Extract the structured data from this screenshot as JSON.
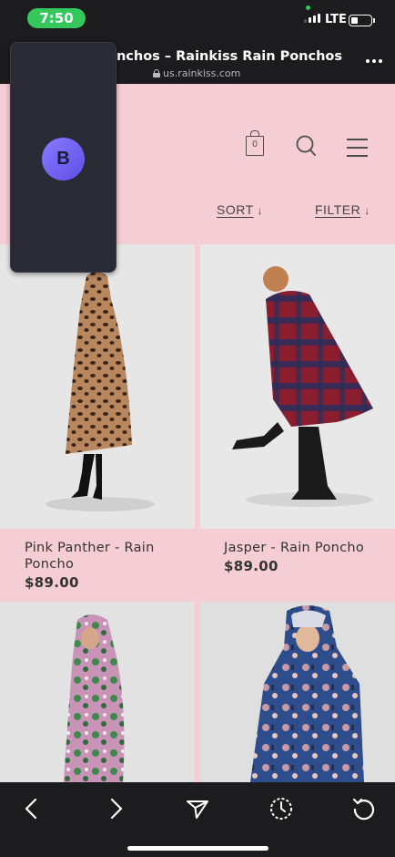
{
  "status": {
    "time": "7:50",
    "network": "LTE"
  },
  "browser": {
    "title": "onchos – Rainkiss Rain Ponchos",
    "url": "us.rainkiss.com"
  },
  "tab_preview": {
    "avatar_letter": "B"
  },
  "header": {
    "cart_count": "0",
    "sort_label": "SORT",
    "filter_label": "FILTER"
  },
  "products": [
    {
      "name": "Pink Panther - Rain Poncho",
      "price": "$89.00"
    },
    {
      "name": "Jasper - Rain Poncho",
      "price": "$89.00"
    }
  ],
  "toolbar": {
    "icons": [
      "back-icon",
      "forward-icon",
      "share-icon",
      "history-icon",
      "reload-icon"
    ]
  },
  "colors": {
    "site_pink": "#f5cdd5",
    "time_pill": "#34c759",
    "chrome_dark": "#1c1c1e"
  }
}
